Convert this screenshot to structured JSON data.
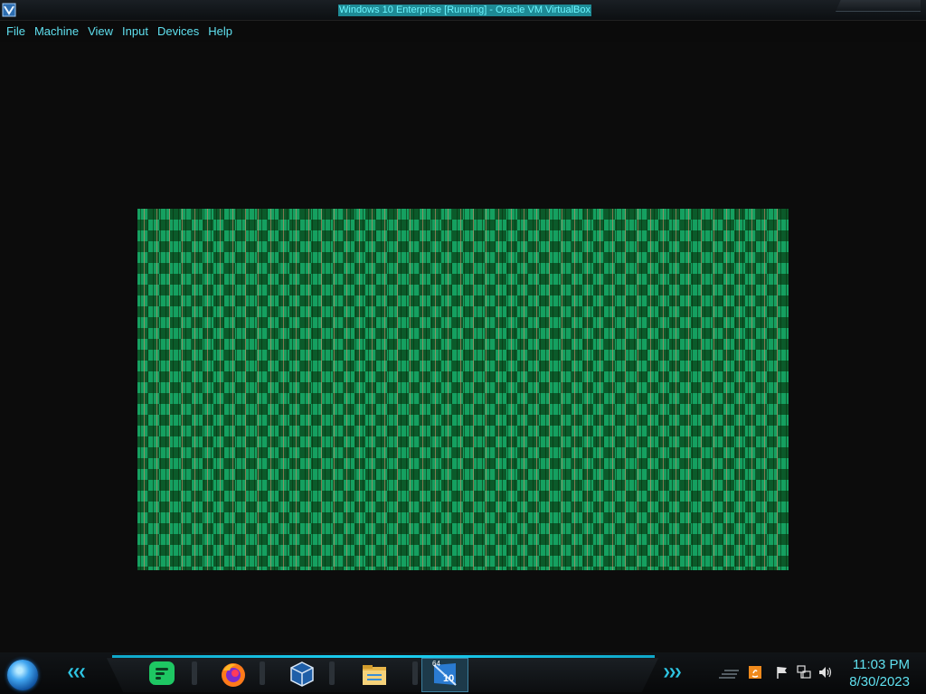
{
  "window": {
    "title": "Windows 10 Enterprise [Running] - Oracle VM VirtualBox",
    "app_icon": "virtualbox-icon"
  },
  "menu": [
    {
      "label": "File"
    },
    {
      "label": "Machine"
    },
    {
      "label": "View"
    },
    {
      "label": "Input"
    },
    {
      "label": "Devices"
    },
    {
      "label": "Help"
    }
  ],
  "vm": {
    "pattern_colors": {
      "primary": "#15a060",
      "secondary": "#0b5a2a",
      "accent": "#e68c6e"
    }
  },
  "taskbar": {
    "accent_color": "#1bd0f3",
    "pinned": [
      {
        "name": "chat-app-icon"
      },
      {
        "name": "firefox-icon"
      },
      {
        "name": "virtualbox-icon"
      },
      {
        "name": "file-explorer-icon"
      },
      {
        "name": "windows-10-vm-icon",
        "badge_top": "64",
        "badge_bottom": "10"
      }
    ],
    "tray": [
      {
        "name": "show-hidden-icons"
      },
      {
        "name": "java-icon"
      },
      {
        "name": "flag-icon"
      },
      {
        "name": "network-icon"
      },
      {
        "name": "volume-icon"
      }
    ],
    "clock": {
      "time": "11:03 PM",
      "date": "8/30/2023"
    }
  }
}
